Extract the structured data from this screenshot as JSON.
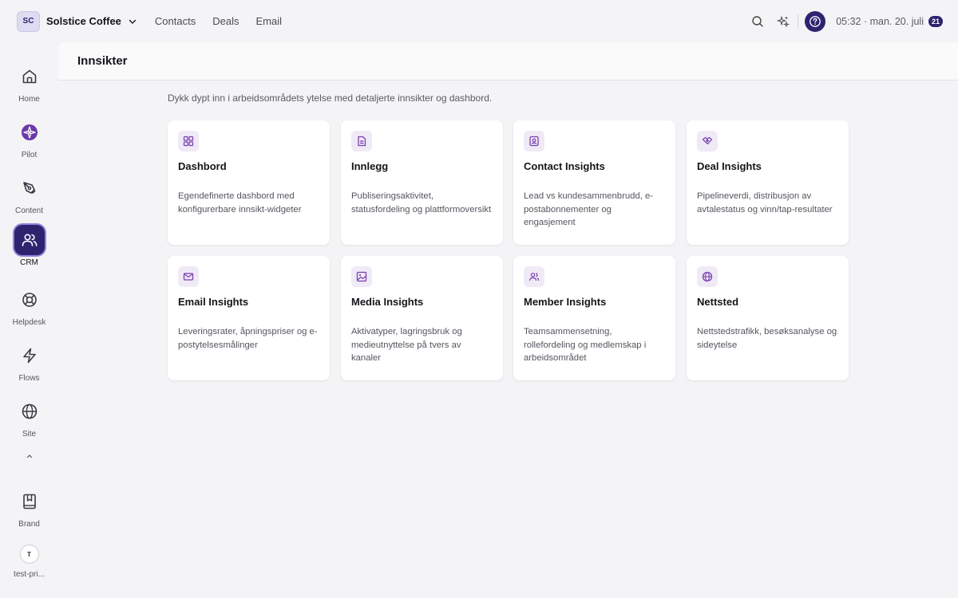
{
  "workspace": {
    "initials": "SC",
    "name": "Solstice Coffee"
  },
  "topnav": [
    "Contacts",
    "Deals",
    "Email"
  ],
  "topbar": {
    "clock": "05:32 · man. 20. juli",
    "day_badge": "21"
  },
  "sidebar": {
    "items": [
      {
        "label": "Home",
        "icon": "home-icon"
      },
      {
        "label": "Pilot",
        "icon": "pilot-icon"
      },
      {
        "label": "Content",
        "icon": "pen-icon"
      },
      {
        "label": "CRM",
        "icon": "users-icon",
        "active": true
      },
      {
        "label": "Helpdesk",
        "icon": "lifebuoy-icon"
      },
      {
        "label": "Flows",
        "icon": "bolt-icon"
      },
      {
        "label": "Site",
        "icon": "globe-icon"
      }
    ],
    "brand": "Brand",
    "user_initial": "T",
    "user_label": "test-pri..."
  },
  "page": {
    "title": "Innsikter",
    "subtitle": "Dykk dypt inn i arbeidsområdets ytelse med detaljerte innsikter og dashbord."
  },
  "cards": [
    {
      "title": "Dashbord",
      "desc": "Egendefinerte dashbord med konfigurerbare innsikt-widgeter",
      "icon": "grid-icon"
    },
    {
      "title": "Innlegg",
      "desc": "Publiseringsaktivitet, statusfordeling og plattformoversikt",
      "icon": "document-icon"
    },
    {
      "title": "Contact Insights",
      "desc": "Lead vs kundesammenbrudd, e-postabonnementer og engasjement",
      "icon": "contact-icon"
    },
    {
      "title": "Deal Insights",
      "desc": "Pipelineverdi, distribusjon av avtalestatus og vinn/tap-resultater",
      "icon": "handshake-icon"
    },
    {
      "title": "Email Insights",
      "desc": "Leveringsrater, åpningspriser og e-postytelsesmålinger",
      "icon": "mail-icon"
    },
    {
      "title": "Media Insights",
      "desc": "Aktivatyper, lagringsbruk og medieutnyttelse på tvers av kanaler",
      "icon": "image-icon"
    },
    {
      "title": "Member Insights",
      "desc": "Teamsammensetning, rollefordeling og medlemskap i arbeidsområdet",
      "icon": "members-icon"
    },
    {
      "title": "Nettsted",
      "desc": "Nettstedstrafikk, besøksanalyse og sideytelse",
      "icon": "globe-icon"
    }
  ],
  "colors": {
    "accent": "#2d2470",
    "icon_tint": "#7a3fb0",
    "card_icon_bg": "#efeaf6"
  }
}
